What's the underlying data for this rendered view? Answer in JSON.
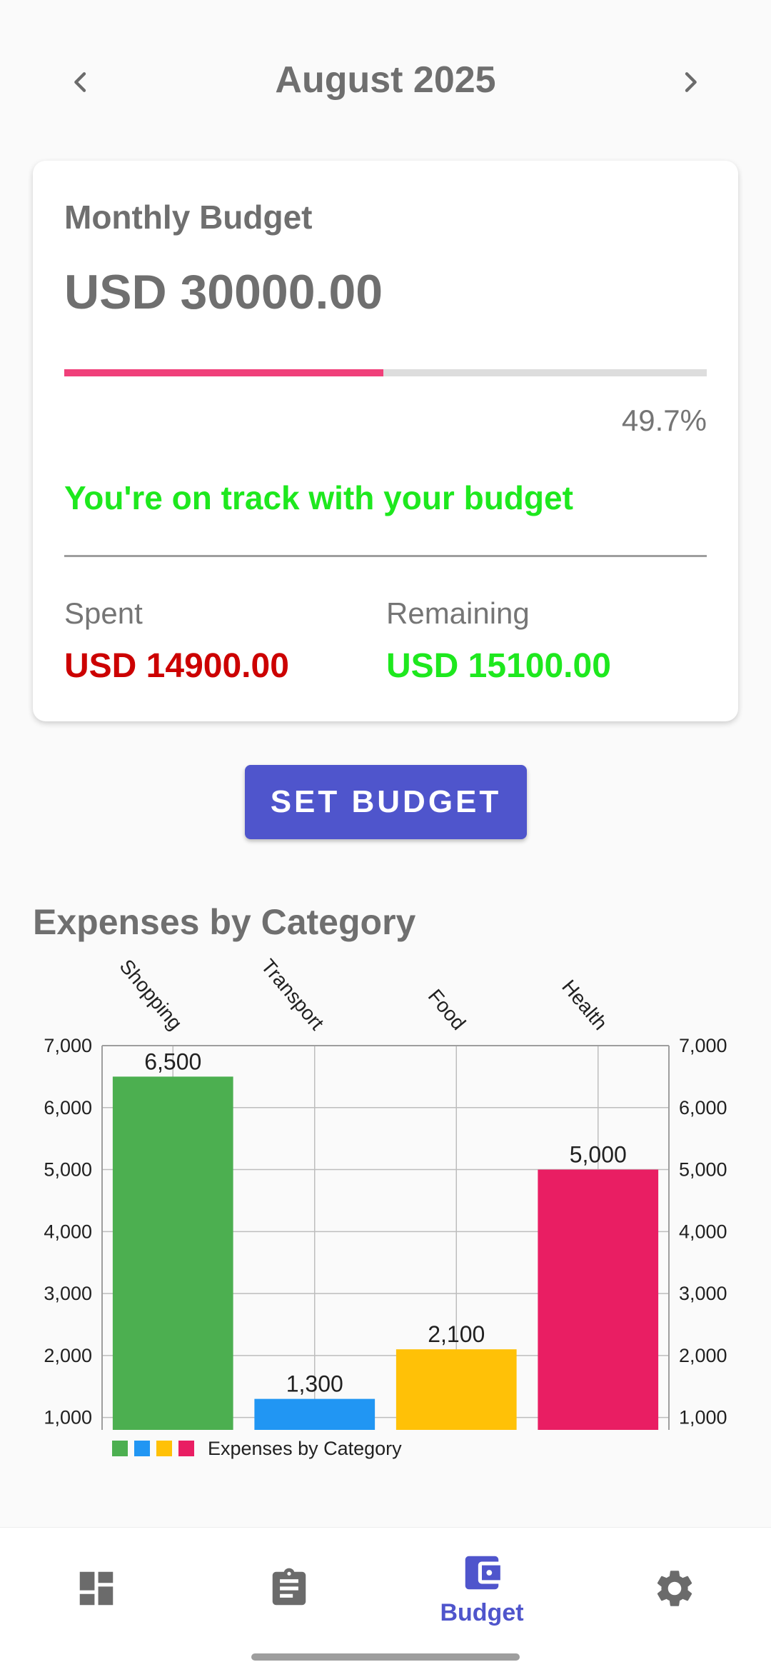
{
  "header": {
    "month_title": "August 2025"
  },
  "budget_card": {
    "title": "Monthly Budget",
    "amount": "USD 30000.00",
    "progress_fraction": 0.497,
    "progress_percent": "49.7%",
    "status": "You're on track with your budget",
    "spent_label": "Spent",
    "spent_value": "USD 14900.00",
    "remaining_label": "Remaining",
    "remaining_value": "USD 15100.00"
  },
  "actions": {
    "set_budget_label": "SET BUDGET"
  },
  "section": {
    "title": "Expenses by Category"
  },
  "chart_data": {
    "type": "bar",
    "categories": [
      "Shopping",
      "Transport",
      "Food",
      "Health"
    ],
    "values": [
      6500,
      1300,
      2100,
      5000
    ],
    "value_labels": [
      "6,500",
      "1,300",
      "2,100",
      "5,000"
    ],
    "colors": [
      "#4caf50",
      "#2196f3",
      "#ffc107",
      "#e91e63"
    ],
    "yticks": [
      1000,
      2000,
      3000,
      4000,
      5000,
      6000,
      7000
    ],
    "ytick_labels": [
      "1,000",
      "2,000",
      "3,000",
      "4,000",
      "5,000",
      "6,000",
      "7,000"
    ],
    "ylim": [
      800,
      7000
    ],
    "legend": "Expenses by Category",
    "legend_position": "bottom-left",
    "grid": true
  },
  "bottom_nav": {
    "items": [
      {
        "icon": "dashboard-icon",
        "label": ""
      },
      {
        "icon": "clipboard-icon",
        "label": ""
      },
      {
        "icon": "wallet-icon",
        "label": "Budget"
      },
      {
        "icon": "gear-icon",
        "label": ""
      }
    ],
    "active_color": "#4f55cc",
    "inactive_color": "#6b6b6b"
  }
}
